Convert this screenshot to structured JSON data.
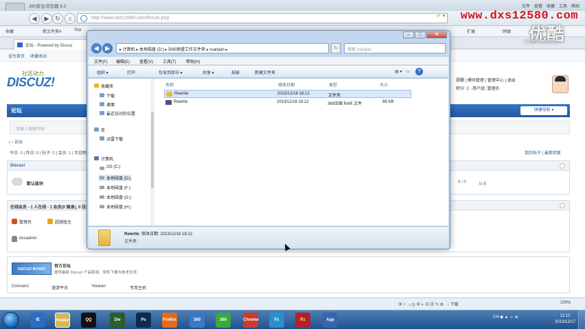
{
  "browser": {
    "title": "360安全浏览器 6.3",
    "title_controls": [
      "文件",
      "查看",
      "收藏",
      "工具",
      "帮助"
    ],
    "address": "http://www.dxs12580.com/forum.php",
    "bookmarks": [
      "收藏",
      "新文件夹4",
      "Sup"
    ],
    "right_tools": [
      "扩展",
      "网银",
      "翻译"
    ],
    "tab_label": "论坛 - Powered by Discuz",
    "status_zoom": "100%",
    "status_tools": "↓ 下载"
  },
  "watermark": {
    "url": "www.dxs12580.com",
    "logo": "优酷",
    "sub": "tv.sohu.com"
  },
  "forum": {
    "top_links": [
      "设为首页",
      "收藏本站"
    ],
    "logo_top": "社区动力",
    "logo_main": "DISCUZ!",
    "user_line1": "提醒 | 模块管理 | 管理中心 | 退出",
    "user_line2": "积分: 2 · 用户组: 管理员",
    "nav_item": "论坛",
    "quick_nav": "快捷导航 ▾",
    "search_placeholder": "请输入搜索内容",
    "breadcrumb": "⌂ › 论坛",
    "stats": "今日: 0 | 昨日: 0 | 帖子: 0 | 会员: 1 | 欢迎新会员: dxsadmin",
    "stats_right": "我的帖子 | 最新回复",
    "group_title": "Discuz!",
    "forum_name": "默认版块",
    "forum_count": "0 / 0",
    "forum_last": "从未",
    "online_title": "在线会员 - 1 人在线 - 1 会员(0 隐身), 0 位游客",
    "legend_admin": "管理员",
    "legend_mod": "超级版主",
    "online_user": "dxsadmin",
    "link_logo": "DISCUZ! BOARD",
    "link_title": "官方论坛",
    "link_desc": "提供最新 Discuz! 产品新闻、软件下载与技术交流",
    "links": [
      "Comsenz",
      "漫游平台",
      "Yeswan",
      "专用主机"
    ]
  },
  "explorer": {
    "path": "▸ 计算机 ▸ 本地磁盘 (D:) ▸ 站长联盟工作文件夹 ▸ ruanjian ▸",
    "search_placeholder": "搜索 ruanjian",
    "menu": [
      "文件(F)",
      "编辑(E)",
      "查看(V)",
      "工具(T)",
      "帮助(H)"
    ],
    "toolbar": [
      "组织 ▾",
      "打开",
      "包含到库中 ▾",
      "共享 ▾",
      "刻录",
      "新建文件夹"
    ],
    "sidebar": {
      "favorites": "收藏夹",
      "fav_items": [
        "下载",
        "桌面",
        "最近访问的位置"
      ],
      "library": "库",
      "lib_items": [
        "迅雷下载"
      ],
      "computer": "计算机",
      "drives": [
        "OS (C:)",
        "本地磁盘 (D:)",
        "本地磁盘 (F:)",
        "本地磁盘 (G:)",
        "本地磁盘 (H:)"
      ]
    },
    "columns": [
      "名称",
      "修改日期",
      "类型",
      "大小"
    ],
    "rows": [
      {
        "name": "Rewrite",
        "date": "2013/12/16 18:12",
        "type": "文件夹",
        "size": ""
      },
      {
        "name": "Rewrite",
        "date": "2013/12/16 18:12",
        "type": "360压缩 RAR 文件",
        "size": "88 KB"
      }
    ],
    "details": {
      "name": "Rewrite",
      "modified_label": "修改日期: 2013/12/16 18:12",
      "type": "文件夹"
    }
  },
  "taskbar": {
    "apps": [
      "IE",
      "Folder",
      "QQ",
      "Dw",
      "Ps",
      "Firefox",
      "360",
      "360",
      "Chrome",
      "Fx",
      "Fz",
      "App"
    ],
    "tray": "CH ◆ ▲ ☼ ◂)",
    "time": "11:12",
    "date": "2013/12/17"
  }
}
